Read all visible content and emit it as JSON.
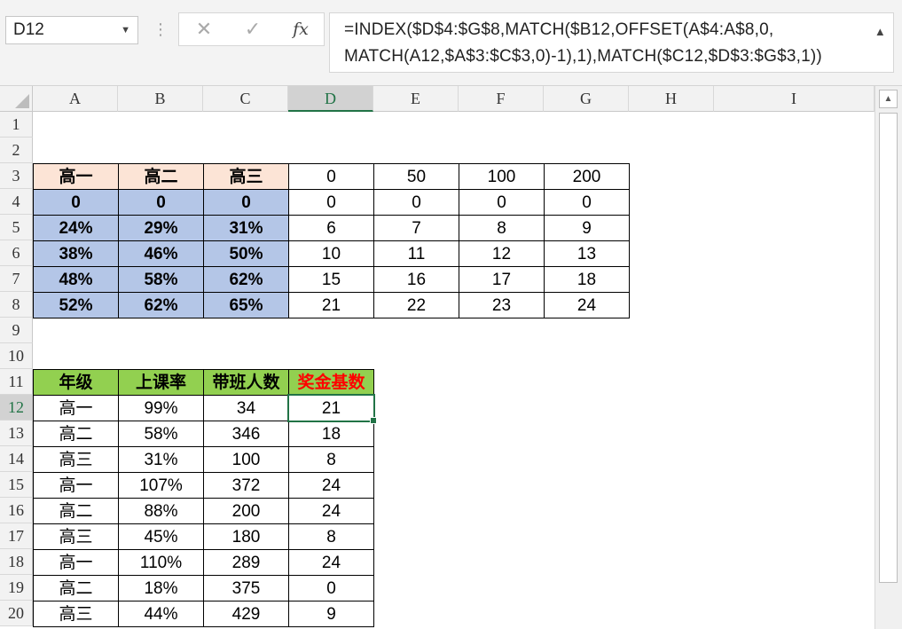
{
  "name_box": "D12",
  "formula": "=INDEX($D$4:$G$8,MATCH($B12,OFFSET(A$4:A$8,0,MATCH(A12,$A$3:$C$3,0)-1),1),MATCH($C12,$D$3:$G$3,1))",
  "formula_line1": "=INDEX($D$4:$G$8,MATCH($B12,OFFSET(A$4:A$8,0,",
  "formula_line2": "MATCH(A12,$A$3:$C$3,0)-1),1),MATCH($C12,$D$3:$G$3,1))",
  "icons": {
    "cancel": "close-icon",
    "enter": "checkmark-icon",
    "function": "fx-icon"
  },
  "icon_glyphs": {
    "cancel": "✕",
    "enter": "✓",
    "fx": "fx",
    "dropdown": "▼",
    "dots": "⋮",
    "up": "▲"
  },
  "columns": [
    "A",
    "B",
    "C",
    "D",
    "E",
    "F",
    "G",
    "H",
    "I"
  ],
  "rows": [
    "1",
    "2",
    "3",
    "4",
    "5",
    "6",
    "7",
    "8",
    "9",
    "10",
    "11",
    "12",
    "13",
    "14",
    "15",
    "16",
    "17",
    "18",
    "19",
    "20"
  ],
  "selected": {
    "col": "D",
    "row": "12"
  },
  "colors": {
    "peach": "#fce4d6",
    "blue": "#b4c6e7",
    "green": "#92d050",
    "red_text": "#ff0000",
    "select": "#217346"
  },
  "lookup_table": {
    "headers": [
      "高一",
      "高二",
      "高三",
      "0",
      "50",
      "100",
      "200"
    ],
    "rows": [
      [
        "0",
        "0",
        "0",
        "0",
        "0",
        "0",
        "0"
      ],
      [
        "24%",
        "29%",
        "31%",
        "6",
        "7",
        "8",
        "9"
      ],
      [
        "38%",
        "46%",
        "50%",
        "10",
        "11",
        "12",
        "13"
      ],
      [
        "48%",
        "58%",
        "62%",
        "15",
        "16",
        "17",
        "18"
      ],
      [
        "52%",
        "62%",
        "65%",
        "21",
        "22",
        "23",
        "24"
      ]
    ]
  },
  "data_table": {
    "headers": [
      "年级",
      "上课率",
      "带班人数",
      "奖金基数"
    ],
    "rows": [
      [
        "高一",
        "99%",
        "34",
        "21"
      ],
      [
        "高二",
        "58%",
        "346",
        "18"
      ],
      [
        "高三",
        "31%",
        "100",
        "8"
      ],
      [
        "高一",
        "107%",
        "372",
        "24"
      ],
      [
        "高二",
        "88%",
        "200",
        "24"
      ],
      [
        "高三",
        "45%",
        "180",
        "8"
      ],
      [
        "高一",
        "110%",
        "289",
        "24"
      ],
      [
        "高二",
        "18%",
        "375",
        "0"
      ],
      [
        "高三",
        "44%",
        "429",
        "9"
      ]
    ]
  }
}
